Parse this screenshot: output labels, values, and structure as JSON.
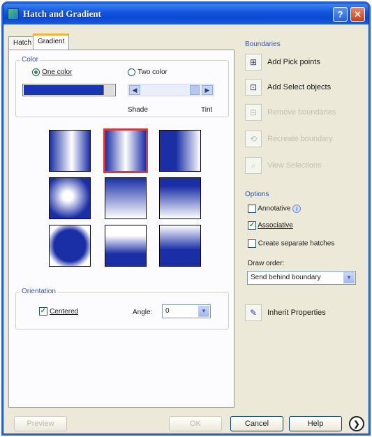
{
  "window": {
    "title": "Hatch and Gradient",
    "help_glyph": "?",
    "close_glyph": "✕"
  },
  "tabs": [
    {
      "label": "Hatch"
    },
    {
      "label": "Gradient"
    }
  ],
  "color": {
    "group_label": "Color",
    "one_color": "One color",
    "two_color": "Two color",
    "selected": "one_color",
    "swatch_color": "#1835b8",
    "shade_label": "Shade",
    "tint_label": "Tint",
    "slider_left_glyph": "◀",
    "slider_right_glyph": "▶"
  },
  "gradients": [
    {
      "style": "linear-h-mirror",
      "selected": false
    },
    {
      "style": "cylinder-v",
      "selected": true
    },
    {
      "style": "linear-h",
      "selected": false
    },
    {
      "style": "spherical",
      "selected": false
    },
    {
      "style": "linear-v-mirror",
      "selected": false
    },
    {
      "style": "linear-v",
      "selected": false
    },
    {
      "style": "inv-spherical",
      "selected": false
    },
    {
      "style": "half-v",
      "selected": false
    },
    {
      "style": "curved-v",
      "selected": false
    }
  ],
  "orientation": {
    "group_label": "Orientation",
    "centered_label": "Centered",
    "centered_checked": true,
    "angle_label": "Angle:",
    "angle_value": "0"
  },
  "boundaries": {
    "group_label": "Boundaries",
    "add_pick_points": "Add Pick points",
    "add_select_objects": "Add Select objects",
    "remove_boundaries": "Remove boundaries",
    "recreate_boundary": "Recreate boundary",
    "view_selections": "View Selections"
  },
  "options": {
    "group_label": "Options",
    "annotative": "Annotative",
    "annotative_checked": false,
    "associative": "Associative",
    "associative_checked": true,
    "separate_hatches": "Create separate hatches",
    "separate_checked": false,
    "draw_order_label": "Draw order:",
    "draw_order_value": "Send behind boundary"
  },
  "inherit_properties": "Inherit Properties",
  "footer": {
    "preview": "Preview",
    "ok": "OK",
    "cancel": "Cancel",
    "help": "Help",
    "more_glyph": "❯"
  },
  "colors": {
    "title_bar": "#1656e0",
    "gradient_dark": "#1a2fa6",
    "selection": "#d63a3a",
    "group_label": "#3155bd"
  }
}
